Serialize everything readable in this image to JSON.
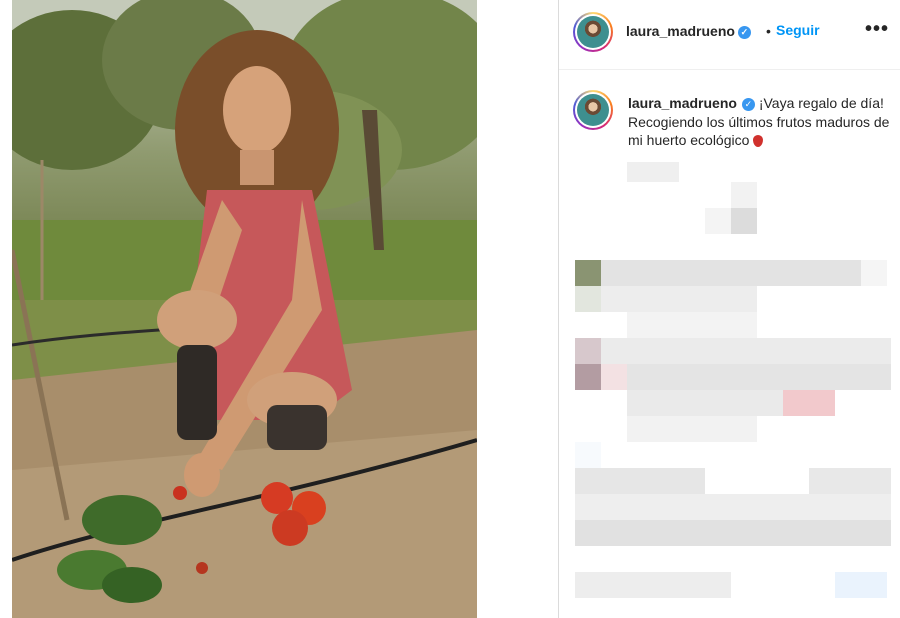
{
  "post": {
    "username": "laura_madrueno",
    "follow_label": "Seguir",
    "separator": "•",
    "more_label": "•••",
    "verified_glyph": "✓",
    "caption_text": "¡Vaya regalo de día! Recogiendo los últimos frutos maduros de mi huerto ecológico"
  },
  "icons": [
    "verified-badge-icon",
    "more-options-icon",
    "strawberry-emoji-icon"
  ],
  "colors": {
    "follow_blue": "#0095f6",
    "verified_blue": "#3897f0",
    "text": "#262626",
    "border": "#dbdbdb"
  }
}
